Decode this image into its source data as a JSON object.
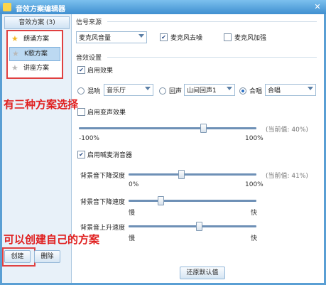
{
  "window": {
    "title": "音效方案编辑器"
  },
  "left": {
    "header": "音效方案 (3)",
    "plans": [
      {
        "label": "朗诵方案",
        "icon": "star-icon"
      },
      {
        "label": "K歌方案",
        "icon": "star-icon"
      },
      {
        "label": "讲座方案",
        "icon": "star-icon"
      }
    ],
    "create_label": "创建",
    "delete_label": "删除"
  },
  "annotations": {
    "choose": "有三种方案选择",
    "create": "可以创建自己的方案"
  },
  "signal": {
    "title": "信号来源",
    "source_value": "麦克风音量",
    "denoise_label": "麦克风去噪",
    "denoise_checked": true,
    "boost_label": "麦克风加强",
    "boost_checked": false
  },
  "effects": {
    "title": "音效设置",
    "enable_label": "启用效果",
    "enable_checked": true,
    "reverb_label": "混响",
    "reverb_value": "音乐厅",
    "echo_label": "回声",
    "echo_value": "山间回声1",
    "chorus_label": "合唱",
    "chorus_value": "合唱",
    "selected_mode": "chorus",
    "voice_change_label": "启用变声效果",
    "voice_min": "-100%",
    "voice_max": "100%",
    "voice_current": "(当前值: 40%)",
    "voice_value": 0.4,
    "vocal_remove_label": "启用喊麦消音器",
    "vocal_remove_checked": true,
    "bg_depth_label": "背景音下降深度",
    "bg_depth_min": "0%",
    "bg_depth_max": "100%",
    "bg_depth_current": "(当前值: 41%)",
    "bg_depth_value": 0.41,
    "bg_down_speed_label": "背景音下降速度",
    "bg_down_slow": "慢",
    "bg_down_fast": "快",
    "bg_down_value": 0.25,
    "bg_up_speed_label": "背景音上升速度",
    "bg_up_slow": "慢",
    "bg_up_fast": "快",
    "bg_up_value": 0.55,
    "restore_label": "还原默认值"
  }
}
